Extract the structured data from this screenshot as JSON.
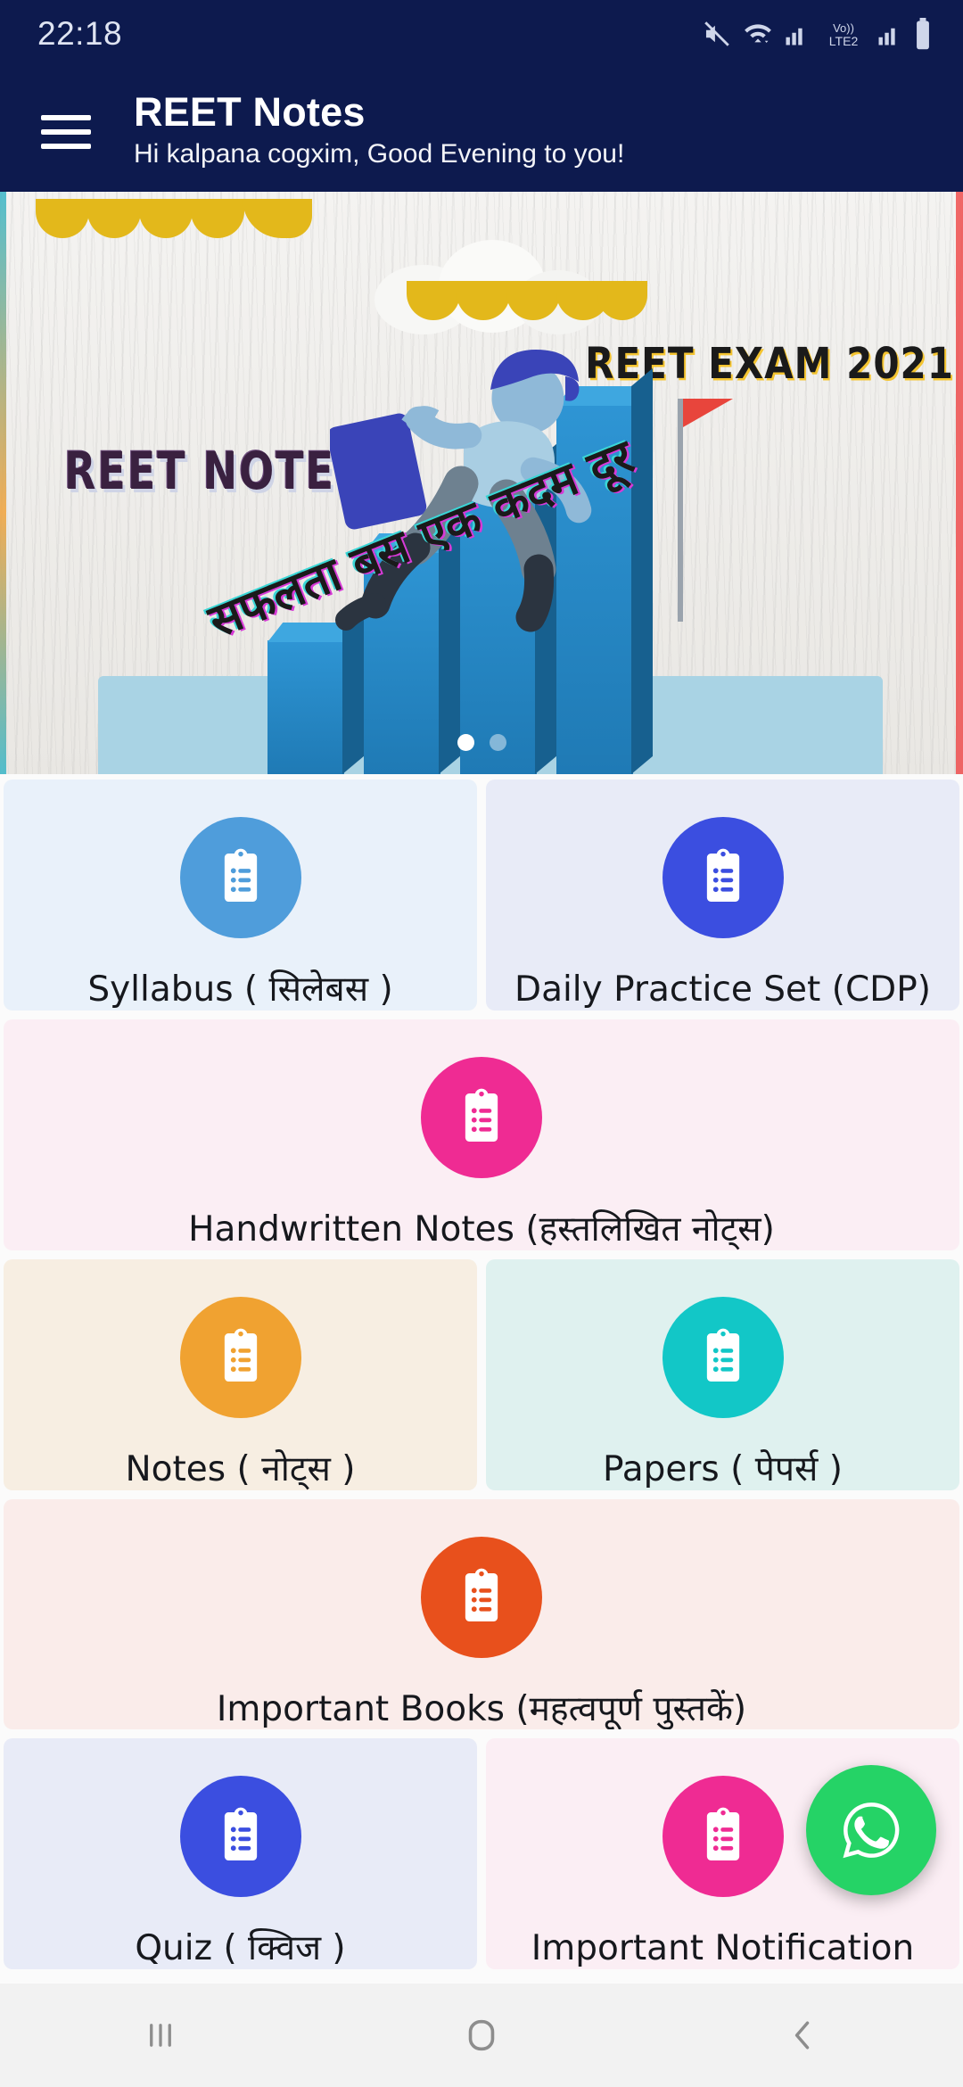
{
  "status_bar": {
    "time": "22:18",
    "icons": [
      "mute-icon",
      "wifi-icon",
      "signal-icon",
      "volte2-icon",
      "signal2-icon",
      "battery-icon"
    ],
    "network_label": "Vo)) LTE2"
  },
  "app_bar": {
    "menu_icon": "hamburger-icon",
    "title": "REET Notes",
    "greeting": "Hi kalpana cogxim, Good Evening to you!",
    "background_color": "#0d1a4e"
  },
  "banner": {
    "logo_text": "REET NOTES",
    "exam_text": "REET EXAM 2021",
    "tagline_hindi": "सफलता बस एक कदम दूर",
    "carousel": {
      "total_dots": 2,
      "active_index": 0
    }
  },
  "menu": {
    "rows": [
      {
        "cards": [
          {
            "label": "Syllabus ( सिलेबस )",
            "icon": "clipboard-list-icon",
            "icon_color": "#4f9ddb",
            "card_color": "#e9f1fa"
          },
          {
            "label": "Daily Practice Set (CDP)",
            "icon": "clipboard-list-icon",
            "icon_color": "#3b4ee0",
            "card_color": "#e8ebf7"
          }
        ]
      },
      {
        "cards": [
          {
            "label": "Handwritten Notes (हस्तलिखित नोट्स)",
            "icon": "clipboard-list-icon",
            "icon_color": "#ef2b93",
            "card_color": "#fbeef4"
          }
        ]
      },
      {
        "cards": [
          {
            "label": "Notes ( नोट्स )",
            "icon": "clipboard-list-icon",
            "icon_color": "#f0a231",
            "card_color": "#f7eee2"
          },
          {
            "label": "Papers ( पेपर्स )",
            "icon": "clipboard-list-icon",
            "icon_color": "#12c7c7",
            "card_color": "#dff1ef"
          }
        ]
      },
      {
        "cards": [
          {
            "label": "Important Books (महत्वपूर्ण पुस्तकें)",
            "icon": "clipboard-list-icon",
            "icon_color": "#e8501c",
            "card_color": "#faecea"
          }
        ]
      },
      {
        "cards": [
          {
            "label": "Quiz ( क्विज )",
            "icon": "clipboard-list-icon",
            "icon_color": "#3b4ee0",
            "card_color": "#e8ebf7"
          },
          {
            "label": "Important Notification",
            "icon": "clipboard-list-icon",
            "icon_color": "#ef2b93",
            "card_color": "#fbeef4"
          }
        ]
      }
    ]
  },
  "fab": {
    "icon": "whatsapp-icon",
    "color": "#25d366"
  },
  "nav_bar": {
    "recents_icon": "recents-icon",
    "home_icon": "home-icon",
    "back_icon": "back-icon"
  }
}
